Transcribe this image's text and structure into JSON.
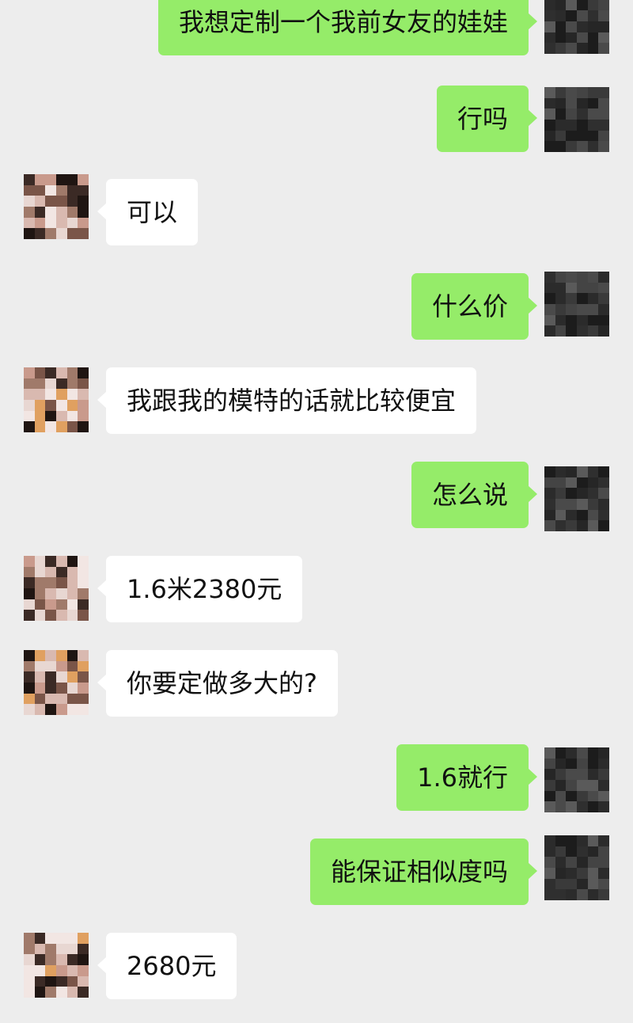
{
  "chat": {
    "messages": [
      {
        "sender": "me",
        "text": "我想定制一个我前女友的娃娃"
      },
      {
        "sender": "me",
        "text": "行吗"
      },
      {
        "sender": "them",
        "text": "可以"
      },
      {
        "sender": "me",
        "text": "什么价"
      },
      {
        "sender": "them",
        "text": "我跟我的模特的话就比较便宜"
      },
      {
        "sender": "me",
        "text": "怎么说"
      },
      {
        "sender": "them",
        "text": "1.6米2380元"
      },
      {
        "sender": "them",
        "text": "你要定做多大的?"
      },
      {
        "sender": "me",
        "text": "1.6就行"
      },
      {
        "sender": "me",
        "text": "能保证相似度吗"
      },
      {
        "sender": "them",
        "text": "2680元"
      }
    ]
  },
  "colors": {
    "background": "#ededed",
    "my_bubble": "#95ec69",
    "their_bubble": "#ffffff"
  },
  "icons": {
    "my_avatar": "pixelated-avatar-icon",
    "their_avatar": "pixelated-avatar-icon"
  }
}
